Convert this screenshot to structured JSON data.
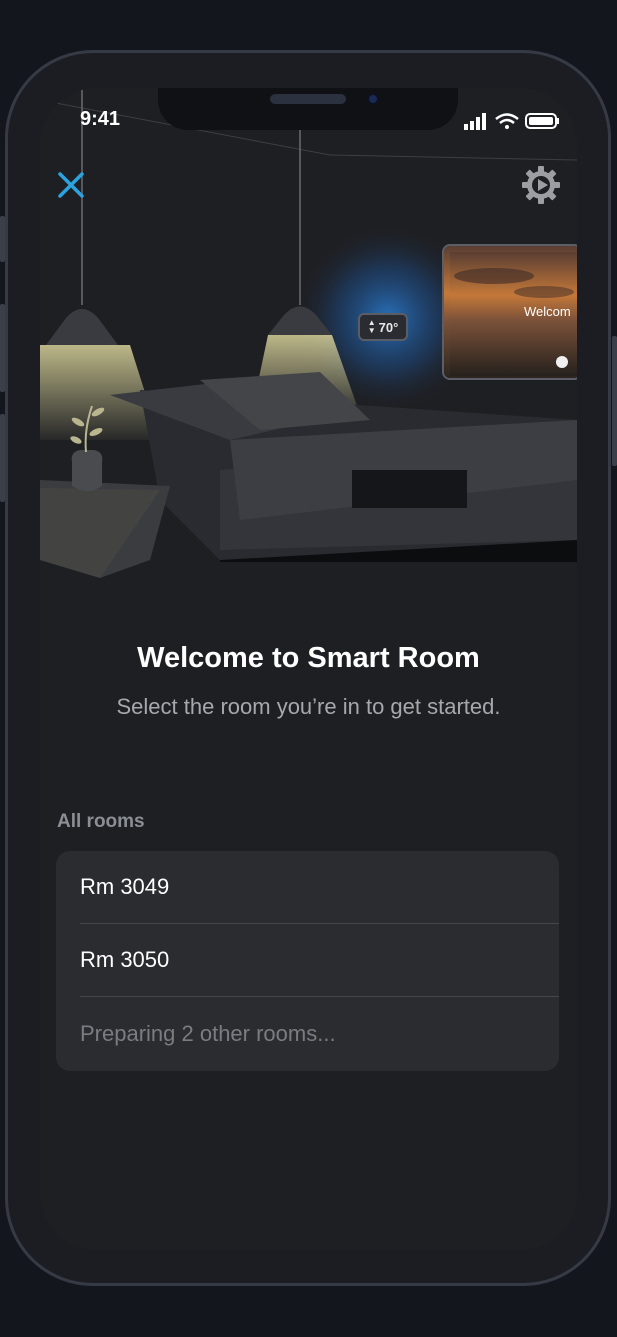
{
  "status_bar": {
    "time": "9:41"
  },
  "header": {
    "close_icon": "close-icon",
    "settings_icon": "gear-icon"
  },
  "illustration": {
    "thermostat": "70°",
    "tv_text": "Welcom"
  },
  "welcome": {
    "title": "Welcome to Smart Room",
    "subtitle": "Select the room you’re in to get started."
  },
  "rooms": {
    "section_label": "All rooms",
    "items": [
      {
        "label": "Rm 3049"
      },
      {
        "label": "Rm 3050"
      }
    ],
    "pending_label": "Preparing 2 other rooms..."
  },
  "colors": {
    "accent": "#2aa3e0",
    "background": "#1e1f23",
    "card": "#2b2c30"
  }
}
